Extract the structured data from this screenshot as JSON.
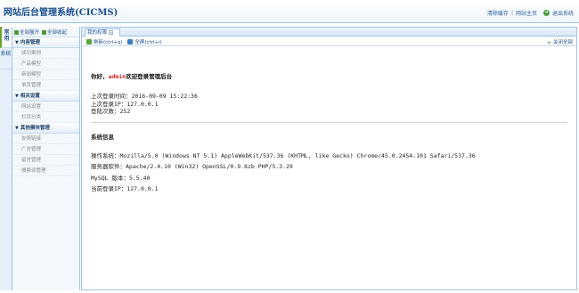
{
  "header": {
    "app_title": "网站后台管理系统(CICMS)",
    "links": {
      "clear_cache": "清除缓存",
      "separator": "|",
      "site_home": "网站主页",
      "logout": "退出系统"
    }
  },
  "vertical_tabs": [
    {
      "label": "常用",
      "active": true
    },
    {
      "label": "系统",
      "active": false
    }
  ],
  "sidebar": {
    "expand_all": "全部展开",
    "collapse_all": "全部收起",
    "groups": [
      {
        "title": "内容管理",
        "items": [
          "成功案例",
          "产品模型",
          "新闻模型",
          "单页管理"
        ]
      },
      {
        "title": "相关设置",
        "items": [
          "网站设置",
          "栏目分类"
        ]
      },
      {
        "title": "其他模块管理",
        "items": [
          "友情链接",
          "广告管理",
          "留言管理",
          "搜索词管理"
        ]
      }
    ]
  },
  "main": {
    "tab_label": "我的权限",
    "refresh": "刷新(ctrl+q)",
    "fullscreen": "全屏(ctrl+i)",
    "close_all": "关闭全部",
    "welcome_prefix": "你好，",
    "username": "admin",
    "welcome_suffix": "欢迎登录管理后台",
    "last_login_time": "上次登录时间：2016-09-09 15:22:36",
    "last_login_ip": "上次登录IP：127.0.0.1",
    "login_count": "登陆次数：252",
    "sys_title": "系统信息",
    "os": "操作系统：Mozilla/5.0 (Windows NT 5.1) AppleWebKit/537.36 (KHTML, like Gecko) Chrome/45.0.2454.101 Safari/537.36",
    "server": "服务器软件：Apache/2.4.10 (Win32) OpenSSL/0.9.8zb PHP/5.3.29",
    "mysql": "MySQL 版本：5.5.40",
    "current_ip": "当前登录IP：127.0.0.1"
  },
  "colors": {
    "accent": "#1a4f8f",
    "border": "#9fc4e6",
    "username": "#d02020",
    "icon_green": "#4a9b3a"
  }
}
